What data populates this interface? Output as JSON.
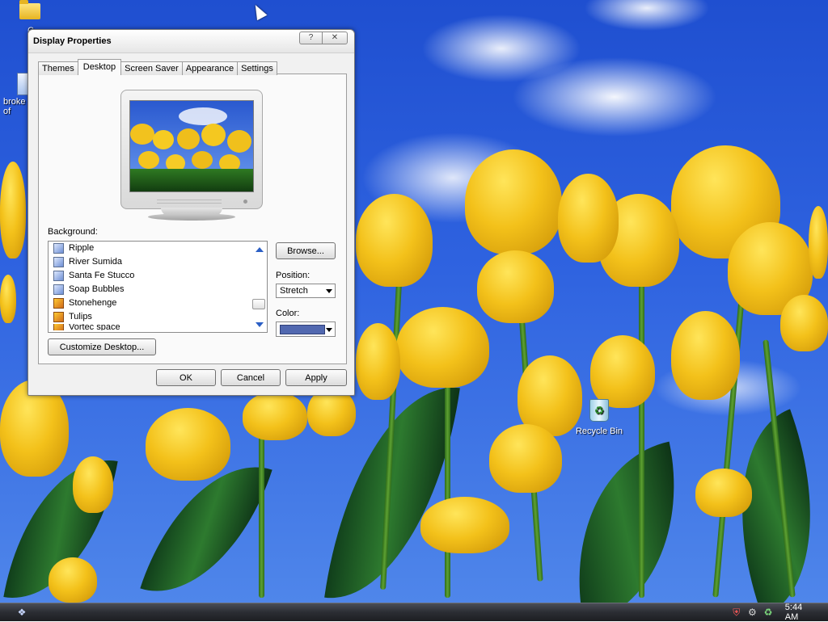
{
  "desktop": {
    "icons": {
      "top_folder": "C",
      "broken_shortcut": "broke\nof",
      "recycle_bin": "Recycle Bin"
    }
  },
  "window": {
    "title": "Display Properties",
    "help_symbol": "?",
    "close_symbol": "✕",
    "tabs": [
      "Themes",
      "Desktop",
      "Screen Saver",
      "Appearance",
      "Settings"
    ],
    "active_tab": "Desktop",
    "background_label": "Background:",
    "background_items": [
      "Ripple",
      "River Sumida",
      "Santa Fe Stucco",
      "Soap Bubbles",
      "Stonehenge",
      "Tulips",
      "Vortec space"
    ],
    "browse_label": "Browse...",
    "position_label": "Position:",
    "position_value": "Stretch",
    "color_label": "Color:",
    "color_value": "#5168b0",
    "customize_label": "Customize Desktop...",
    "ok_label": "OK",
    "cancel_label": "Cancel",
    "apply_label": "Apply"
  },
  "taskbar": {
    "clock": "5:44 AM",
    "tray_icons": [
      "shield-icon",
      "network-icon",
      "recycle-tray-icon"
    ]
  }
}
